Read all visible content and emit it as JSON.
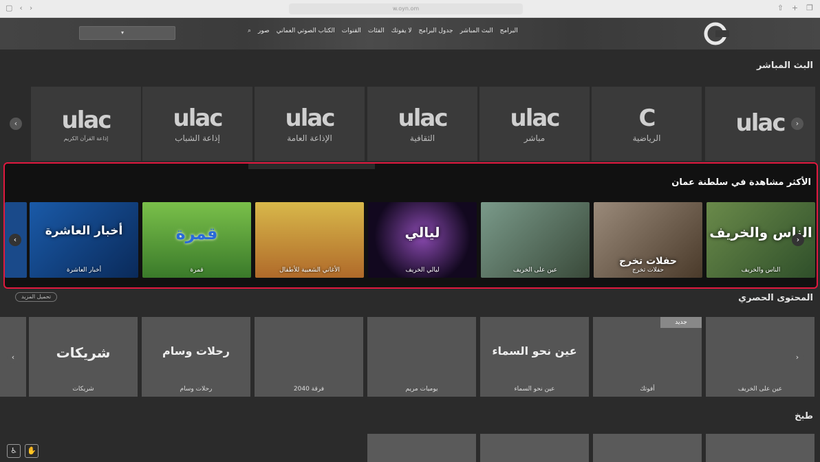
{
  "browser": {
    "url": "w.oyn.om"
  },
  "header": {
    "nav_items": [
      "البرامج",
      "البث المباشر",
      "جدول البرامج",
      "لا يفوتك",
      "الفئات",
      "القنوات",
      "الكتاب الصوتي العماني",
      "صور"
    ],
    "logo_text": ""
  },
  "live": {
    "title": "البث المباشر",
    "channels": [
      {
        "label": ""
      },
      {
        "label": "الرياضية"
      },
      {
        "label": "مباشر"
      },
      {
        "label": "الثقافية"
      },
      {
        "label": "الإذاعة العامة"
      },
      {
        "label": "إذاعة الشباب"
      },
      {
        "label": "إذاعة القرآن الكريم"
      }
    ]
  },
  "most_watched": {
    "title": "الأكثر مشاهدة في سلطنة عمان",
    "items": [
      {
        "label": "الناس والخريف",
        "art": "الناس والخريف",
        "color": "#3f6b3a"
      },
      {
        "label": "حفلات تخرج",
        "art": "حفلات تخرج",
        "color": "#6a5a4a"
      },
      {
        "label": "عين على الخريف",
        "art": "",
        "color": "#4f6b5a"
      },
      {
        "label": "ليالي الخريف",
        "art": "ليالي",
        "color": "#2a1a4a"
      },
      {
        "label": "الأغاني الشعبية للأطفال",
        "art": "",
        "color": "#c9a23a"
      },
      {
        "label": "قمرة",
        "art": "قمرة",
        "color": "#6aaa3a"
      },
      {
        "label": "أخبار العاشرة",
        "art": "أخبار العاشرة",
        "color": "#1a4a8a"
      }
    ]
  },
  "exclusive": {
    "title": "المحتوى الحصري",
    "load_more": "تحميل المزيد",
    "new_badge": "جديد",
    "items": [
      {
        "label": "عين على الخريف"
      },
      {
        "label": "أفوتك"
      },
      {
        "label": "عين نحو السماء",
        "art": "عين نحو السماء"
      },
      {
        "label": "يوميات مريم"
      },
      {
        "label": "فرقة 2040"
      },
      {
        "label": "رحلات وسام",
        "art": "رحلات وسام"
      },
      {
        "label": "شريكات",
        "art": "شريكات"
      }
    ]
  },
  "cooking": {
    "title": "طبخ"
  }
}
